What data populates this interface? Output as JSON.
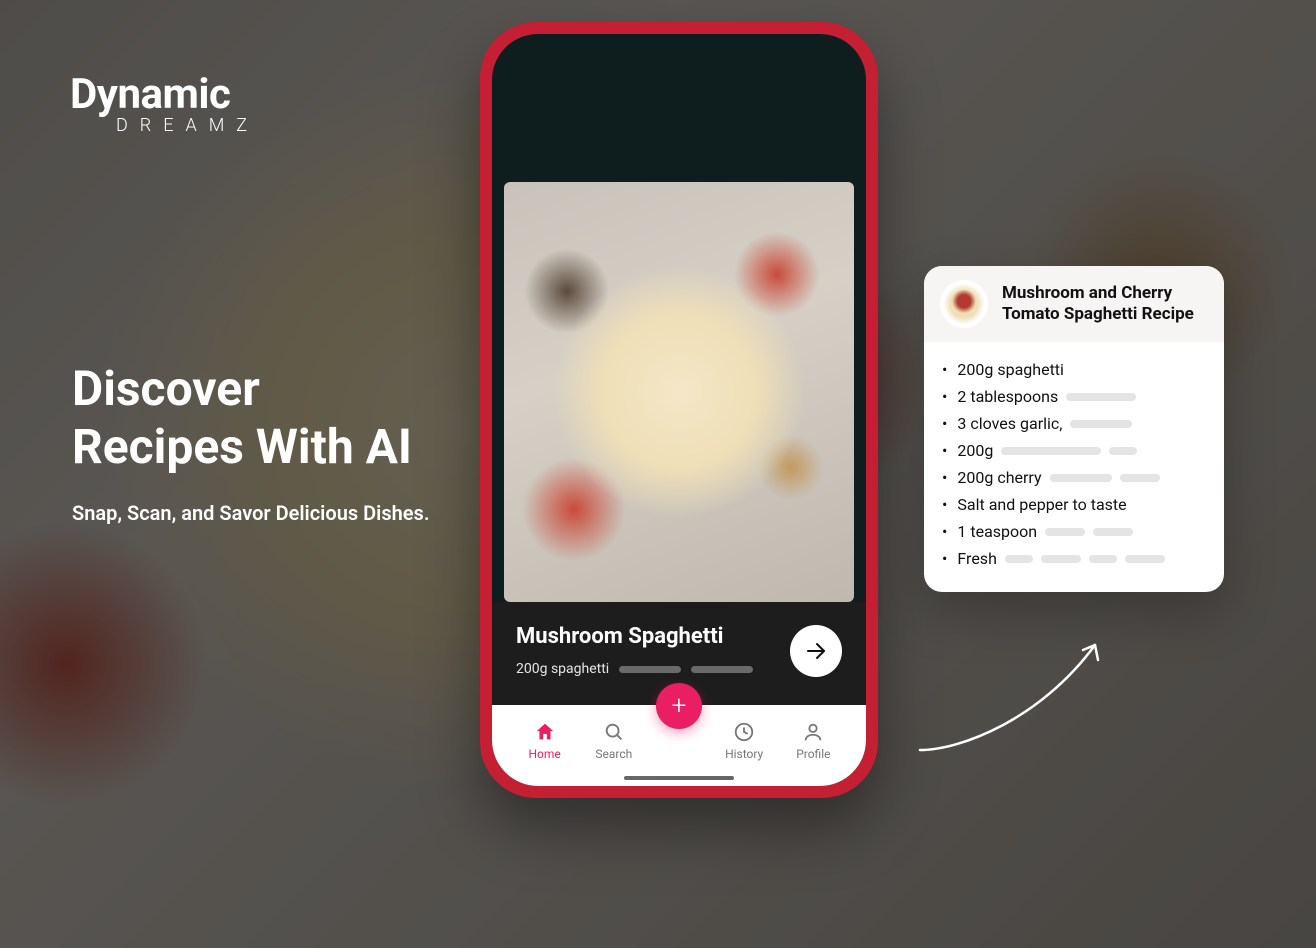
{
  "brand": {
    "name_main": "Dynamic",
    "name_sub": "DREAMZ"
  },
  "hero": {
    "headline_line1": "Discover",
    "headline_line2": "Recipes With AI",
    "tagline": "Snap, Scan, and Savor Delicious Dishes."
  },
  "phone": {
    "caption_title": "Mushroom Spaghetti",
    "caption_sub": "200g spaghetti",
    "nav": {
      "home": "Home",
      "search": "Search",
      "history": "History",
      "profile": "Profile"
    }
  },
  "recipe_card": {
    "title": "Mushroom and Cherry Tomato Spaghetti Recipe",
    "ingredients": [
      "200g spaghetti",
      "2 tablespoons",
      "3 cloves garlic,",
      "200g",
      "200g cherry",
      "Salt and pepper to taste",
      "1 teaspoon",
      "Fresh"
    ]
  },
  "colors": {
    "accent": "#e91e63",
    "phone_red": "#c51f34"
  }
}
